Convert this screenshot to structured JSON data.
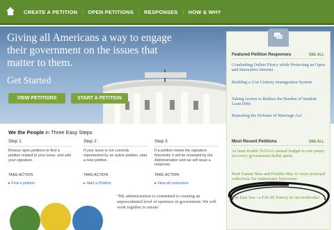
{
  "nav": {
    "items": [
      "CREATE A PETITION",
      "OPEN PETITIONS",
      "RESPONSES",
      "HOW & WHY"
    ]
  },
  "hero": {
    "title": "Giving all Americans a way to engage their government on the issues that matter to them.",
    "get_started": "Get Started",
    "btn_view": "VIEW PETITIONS",
    "btn_start": "START A PETITION"
  },
  "steps": {
    "title_bold": "We the People",
    "title_rest": " in Three Easy Steps",
    "items": [
      {
        "heading": "Step 1",
        "text": "Browse open petitions to find a petition related to your issue, and add your signature.",
        "take": "TAKE ACTION",
        "link": "Find a petition"
      },
      {
        "heading": "Step 2",
        "text": "If your issue is not currently represented by an active petition, start a new petition.",
        "take": "TAKE ACTION",
        "link": "Start a Petition"
      },
      {
        "heading": "Step 3",
        "text": "If a petition meets the signature threshold, it will be reviewed by the Administration and we will issue a response.",
        "take": "TAKE ACTION",
        "link": "View all responses"
      }
    ]
  },
  "quote": "\"My administration is committed to creating an unprecedented level of openness in government. We will work together to ensure",
  "sidebar": {
    "featured_title": "Featured Petition Responses",
    "see_all": "SEE ALL",
    "featured": [
      "Combatting Online Piracy while Protecting an Open and Innovative Internet",
      "Building a 21st Century Immigration System",
      "Taking Action to Reduce the Burden of Student Loan Debt",
      "Repealing the Defense of Marriage Act"
    ],
    "recent_title": "Most Recent Petitions",
    "recent": [
      "At least double NASA's annual budget to one penny for every government dollar spent.",
      "Push Fannie Mae and Freddie Mac to issue principal reductions for underwater borrowers",
      "The East Sea - a FALSE history in our textbooks!"
    ]
  },
  "colors": {
    "nav_green": "#5f8c2f",
    "link_blue": "#3a64a5",
    "button_green": "#7ca43a"
  }
}
